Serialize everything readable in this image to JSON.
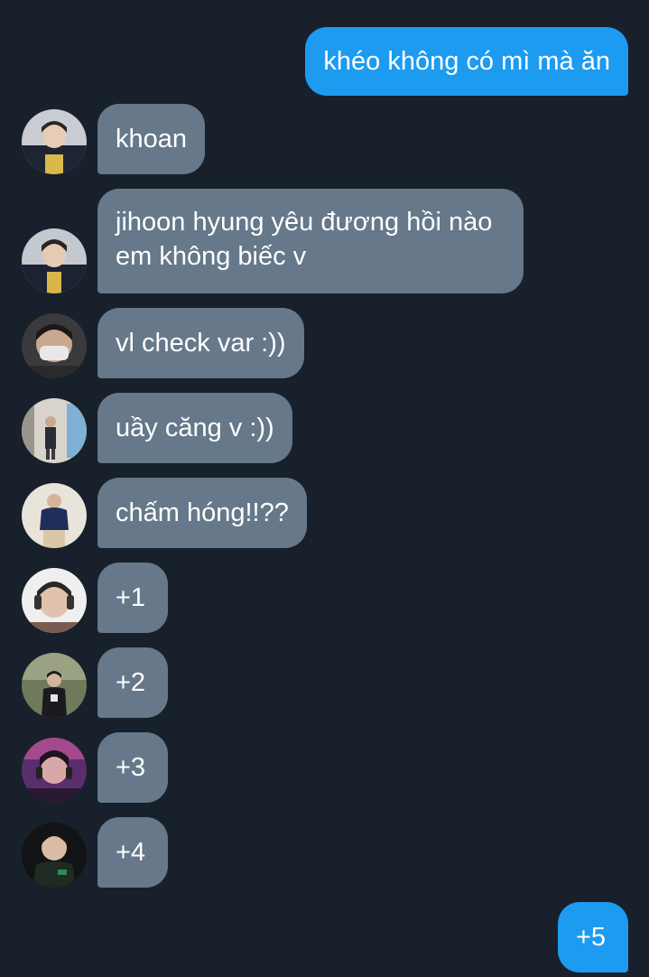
{
  "messages": [
    {
      "side": "out",
      "text": "khéo không có mì mà ăn"
    },
    {
      "side": "in",
      "text": "khoan",
      "avatar": "avatar-jersey-1"
    },
    {
      "side": "in",
      "text": "jihoon hyung yêu đương hồi nào em không biếc v",
      "avatar": "avatar-jersey-2"
    },
    {
      "side": "in",
      "text": "vl check var :))",
      "avatar": "avatar-masked"
    },
    {
      "side": "in",
      "text": "uầy căng v :))",
      "avatar": "avatar-street"
    },
    {
      "side": "in",
      "text": "chấm hóng!!??",
      "avatar": "avatar-navy-sweater"
    },
    {
      "side": "in",
      "text": "+1",
      "avatar": "avatar-headset"
    },
    {
      "side": "in",
      "text": "+2",
      "avatar": "avatar-field"
    },
    {
      "side": "in",
      "text": "+3",
      "avatar": "avatar-purple-stage"
    },
    {
      "side": "in",
      "text": "+4",
      "avatar": "avatar-dark-jersey"
    },
    {
      "side": "out",
      "text": "+5"
    }
  ],
  "colors": {
    "background": "#17202b",
    "outgoing_bubble": "#1d9bf0",
    "incoming_bubble": "#66788a",
    "text": "#ffffff"
  }
}
